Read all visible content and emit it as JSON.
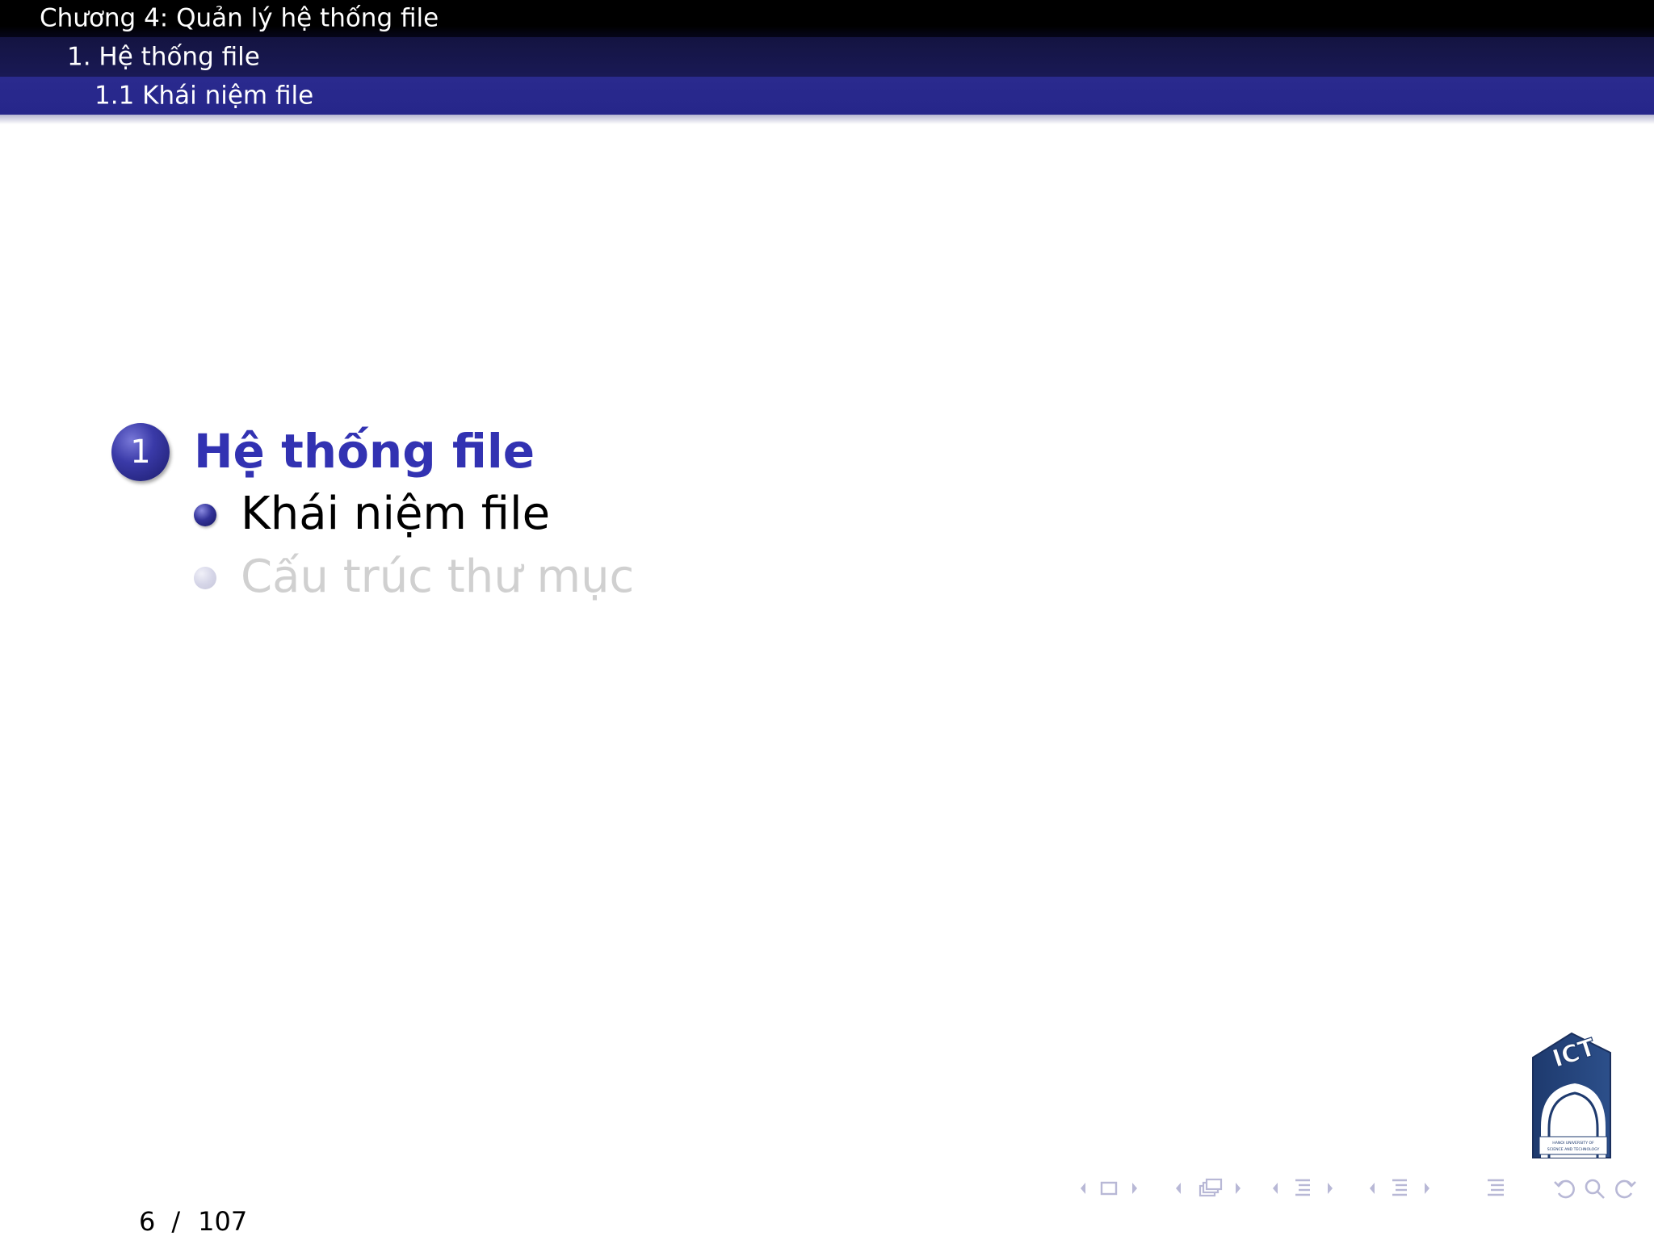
{
  "header": {
    "chapter": "Chương 4: Quản lý hệ thống file",
    "section": "1. Hệ thống file",
    "subsection": "1.1 Khái niệm file"
  },
  "outline": {
    "section_number": "1",
    "section_title": "Hệ thống file",
    "items": [
      {
        "label": "Khái niệm file",
        "state": "active"
      },
      {
        "label": "Cấu trúc thư mục",
        "state": "faded"
      }
    ]
  },
  "logo": {
    "text": "ICT",
    "caption": "HANOI UNIVERSITY OF SCIENCE AND TECHNOLOGY"
  },
  "footer": {
    "current_page": "6",
    "separator": "/",
    "total_pages": "107"
  },
  "colors": {
    "accent": "#3232b2",
    "header_dark": "#000000",
    "header_mid": "#191955",
    "header_light": "#26268a",
    "faded": "#d0d0d0"
  }
}
